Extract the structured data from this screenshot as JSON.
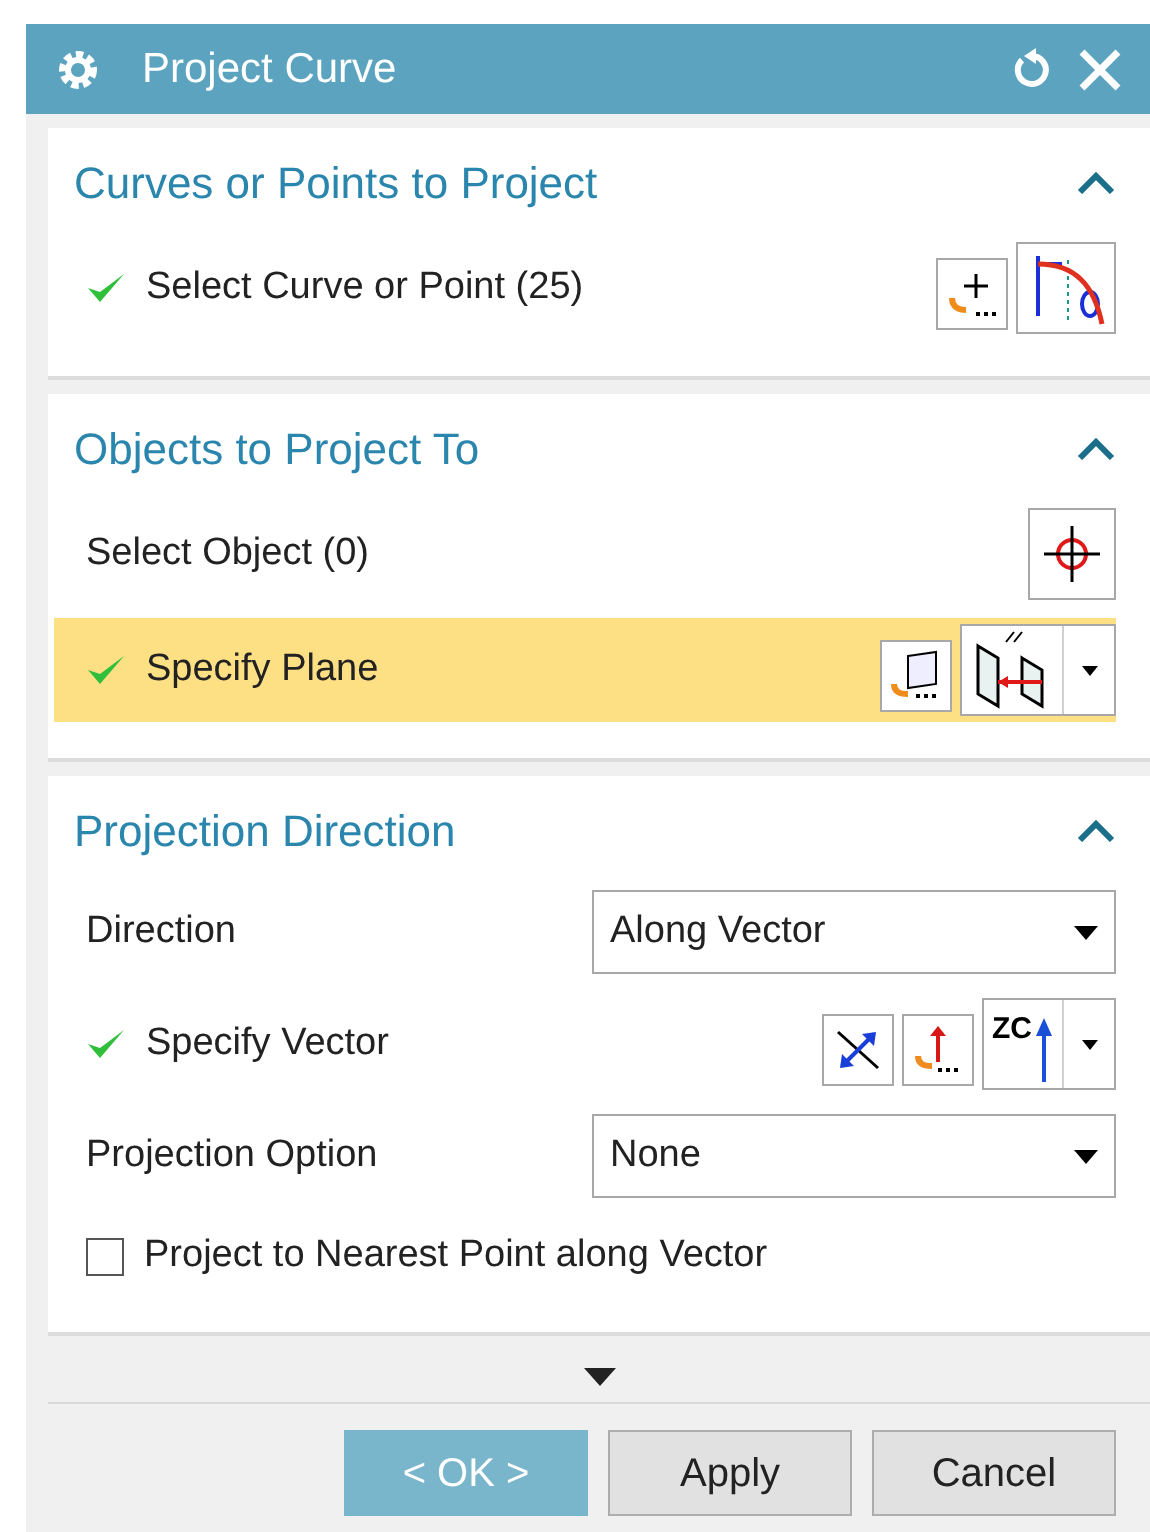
{
  "window": {
    "title": "Project Curve"
  },
  "sections": [
    {
      "title": "Curves or Points to Project",
      "expanded": true,
      "rows": [
        {
          "kind": "selection",
          "label": "Select Curve or Point (25)",
          "done": true,
          "selected": false,
          "tools": [
            {
              "kind": "add-point"
            },
            {
              "kind": "curve-rule",
              "big": true
            }
          ]
        }
      ]
    },
    {
      "title": "Objects to Project To",
      "expanded": true,
      "rows": [
        {
          "kind": "selection",
          "label": "Select Object (0)",
          "done": false,
          "selected": false,
          "tools": [
            {
              "kind": "crosshair",
              "big": true
            }
          ]
        },
        {
          "kind": "selection",
          "label": "Specify Plane",
          "done": true,
          "selected": true,
          "tools": [
            {
              "kind": "plane-dialog"
            },
            {
              "kind": "plane-method",
              "big": true,
              "menu": true
            }
          ]
        }
      ]
    },
    {
      "title": "Projection Direction",
      "expanded": true,
      "rows": [
        {
          "kind": "dropdown",
          "label": "Direction",
          "value": "Along Vector"
        },
        {
          "kind": "selection",
          "label": "Specify Vector",
          "done": true,
          "selected": false,
          "tools": [
            {
              "kind": "reverse"
            },
            {
              "kind": "vector-dialog"
            },
            {
              "kind": "vector-zc",
              "big": true,
              "menu": true,
              "label": "ZC"
            }
          ]
        },
        {
          "kind": "dropdown",
          "label": "Projection Option",
          "value": "None"
        },
        {
          "kind": "checkbox",
          "label": "Project to Nearest Point along Vector",
          "checked": false
        }
      ]
    }
  ],
  "buttons": [
    {
      "label": "< OK >",
      "default": true
    },
    {
      "label": "Apply",
      "default": false
    },
    {
      "label": "Cancel",
      "default": false
    }
  ]
}
